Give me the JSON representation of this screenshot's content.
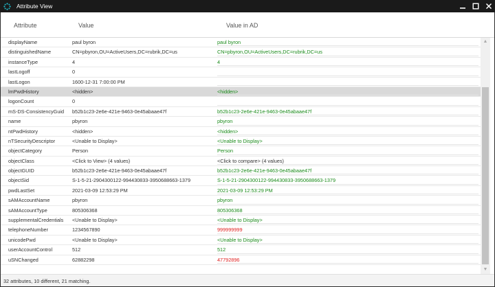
{
  "window": {
    "title": "Attribute View"
  },
  "columns": {
    "attribute": "Attribute",
    "value": "Value",
    "value_ad": "Value in AD"
  },
  "rows": [
    {
      "attr": "displayName",
      "value": "paul byron",
      "ad": "paul byron",
      "status": "match"
    },
    {
      "attr": "distinguishedName",
      "value": "CN=pbyron,OU=ActiveUsers,DC=rubrik,DC=us",
      "ad": "CN=pbyron,OU=ActiveUsers,DC=rubrik,DC=us",
      "status": "match"
    },
    {
      "attr": "instanceType",
      "value": "4",
      "ad": "4",
      "status": "match"
    },
    {
      "attr": "lastLogoff",
      "value": "0",
      "ad": "",
      "status": "none"
    },
    {
      "attr": "lastLogon",
      "value": "1600-12-31 7:00:00 PM",
      "ad": "",
      "status": "none"
    },
    {
      "attr": "lmPwdHistory",
      "value": "<hidden>",
      "ad": "<hidden>",
      "status": "match",
      "selected": true
    },
    {
      "attr": "logonCount",
      "value": "0",
      "ad": "",
      "status": "none"
    },
    {
      "attr": "mS-DS-ConsistencyGuid",
      "value": "b52b1c23-2e6e-421e-9463-0e45abaae47f",
      "ad": "b52b1c23-2e6e-421e-9463-0e45abaae47f",
      "status": "match"
    },
    {
      "attr": "name",
      "value": "pbyron",
      "ad": "pbyron",
      "status": "match"
    },
    {
      "attr": "ntPwdHistory",
      "value": "<hidden>",
      "ad": "<hidden>",
      "status": "match"
    },
    {
      "attr": "nTSecurityDescriptor",
      "value": "<Unable to Display>",
      "ad": "<Unable to Display>",
      "status": "match"
    },
    {
      "attr": "objectCategory",
      "value": "Person",
      "ad": "Person",
      "status": "match"
    },
    {
      "attr": "objectClass",
      "value": "<Click to View> (4 values)",
      "ad": "<Click to compare> (4 values)",
      "status": "neutral"
    },
    {
      "attr": "objectGUID",
      "value": "b52b1c23-2e6e-421e-9463-0e45abaae47f",
      "ad": "b52b1c23-2e6e-421e-9463-0e45abaae47f",
      "status": "match"
    },
    {
      "attr": "objectSid",
      "value": "S-1-5-21-2904300122-994430833-3950688663-1379",
      "ad": "S-1-5-21-2904300122-994430833-3950688663-1379",
      "status": "match"
    },
    {
      "attr": "pwdLastSet",
      "value": "2021-03-09 12:53:29 PM",
      "ad": "2021-03-09 12:53:29 PM",
      "status": "match"
    },
    {
      "attr": "sAMAccountName",
      "value": "pbyron",
      "ad": "pbyron",
      "status": "match"
    },
    {
      "attr": "sAMAccountType",
      "value": "805306368",
      "ad": "805306368",
      "status": "match"
    },
    {
      "attr": "supplementalCredentials",
      "value": "<Unable to Display>",
      "ad": "<Unable to Display>",
      "status": "match"
    },
    {
      "attr": "telephoneNumber",
      "value": "1234567890",
      "ad": "999999999",
      "status": "diff"
    },
    {
      "attr": "unicodePwd",
      "value": "<Unable to Display>",
      "ad": "<Unable to Display>",
      "status": "match"
    },
    {
      "attr": "userAccountControl",
      "value": "512",
      "ad": "512",
      "status": "match"
    },
    {
      "attr": "uSNChanged",
      "value": "62882298",
      "ad": "47792896",
      "status": "diff"
    }
  ],
  "colors": {
    "match": "#1a8a1a",
    "diff": "#e02020",
    "selected_row": "#d9d9d9",
    "titlebar": "#1a1a1a",
    "app_icon": "#1fb8c8"
  },
  "status_bar": {
    "text": "32 attributes, 10 different, 21 matching."
  },
  "icons": {
    "app": "rubrik-logo-icon",
    "minimize": "minimize-icon",
    "maximize": "maximize-icon",
    "close": "close-icon"
  }
}
